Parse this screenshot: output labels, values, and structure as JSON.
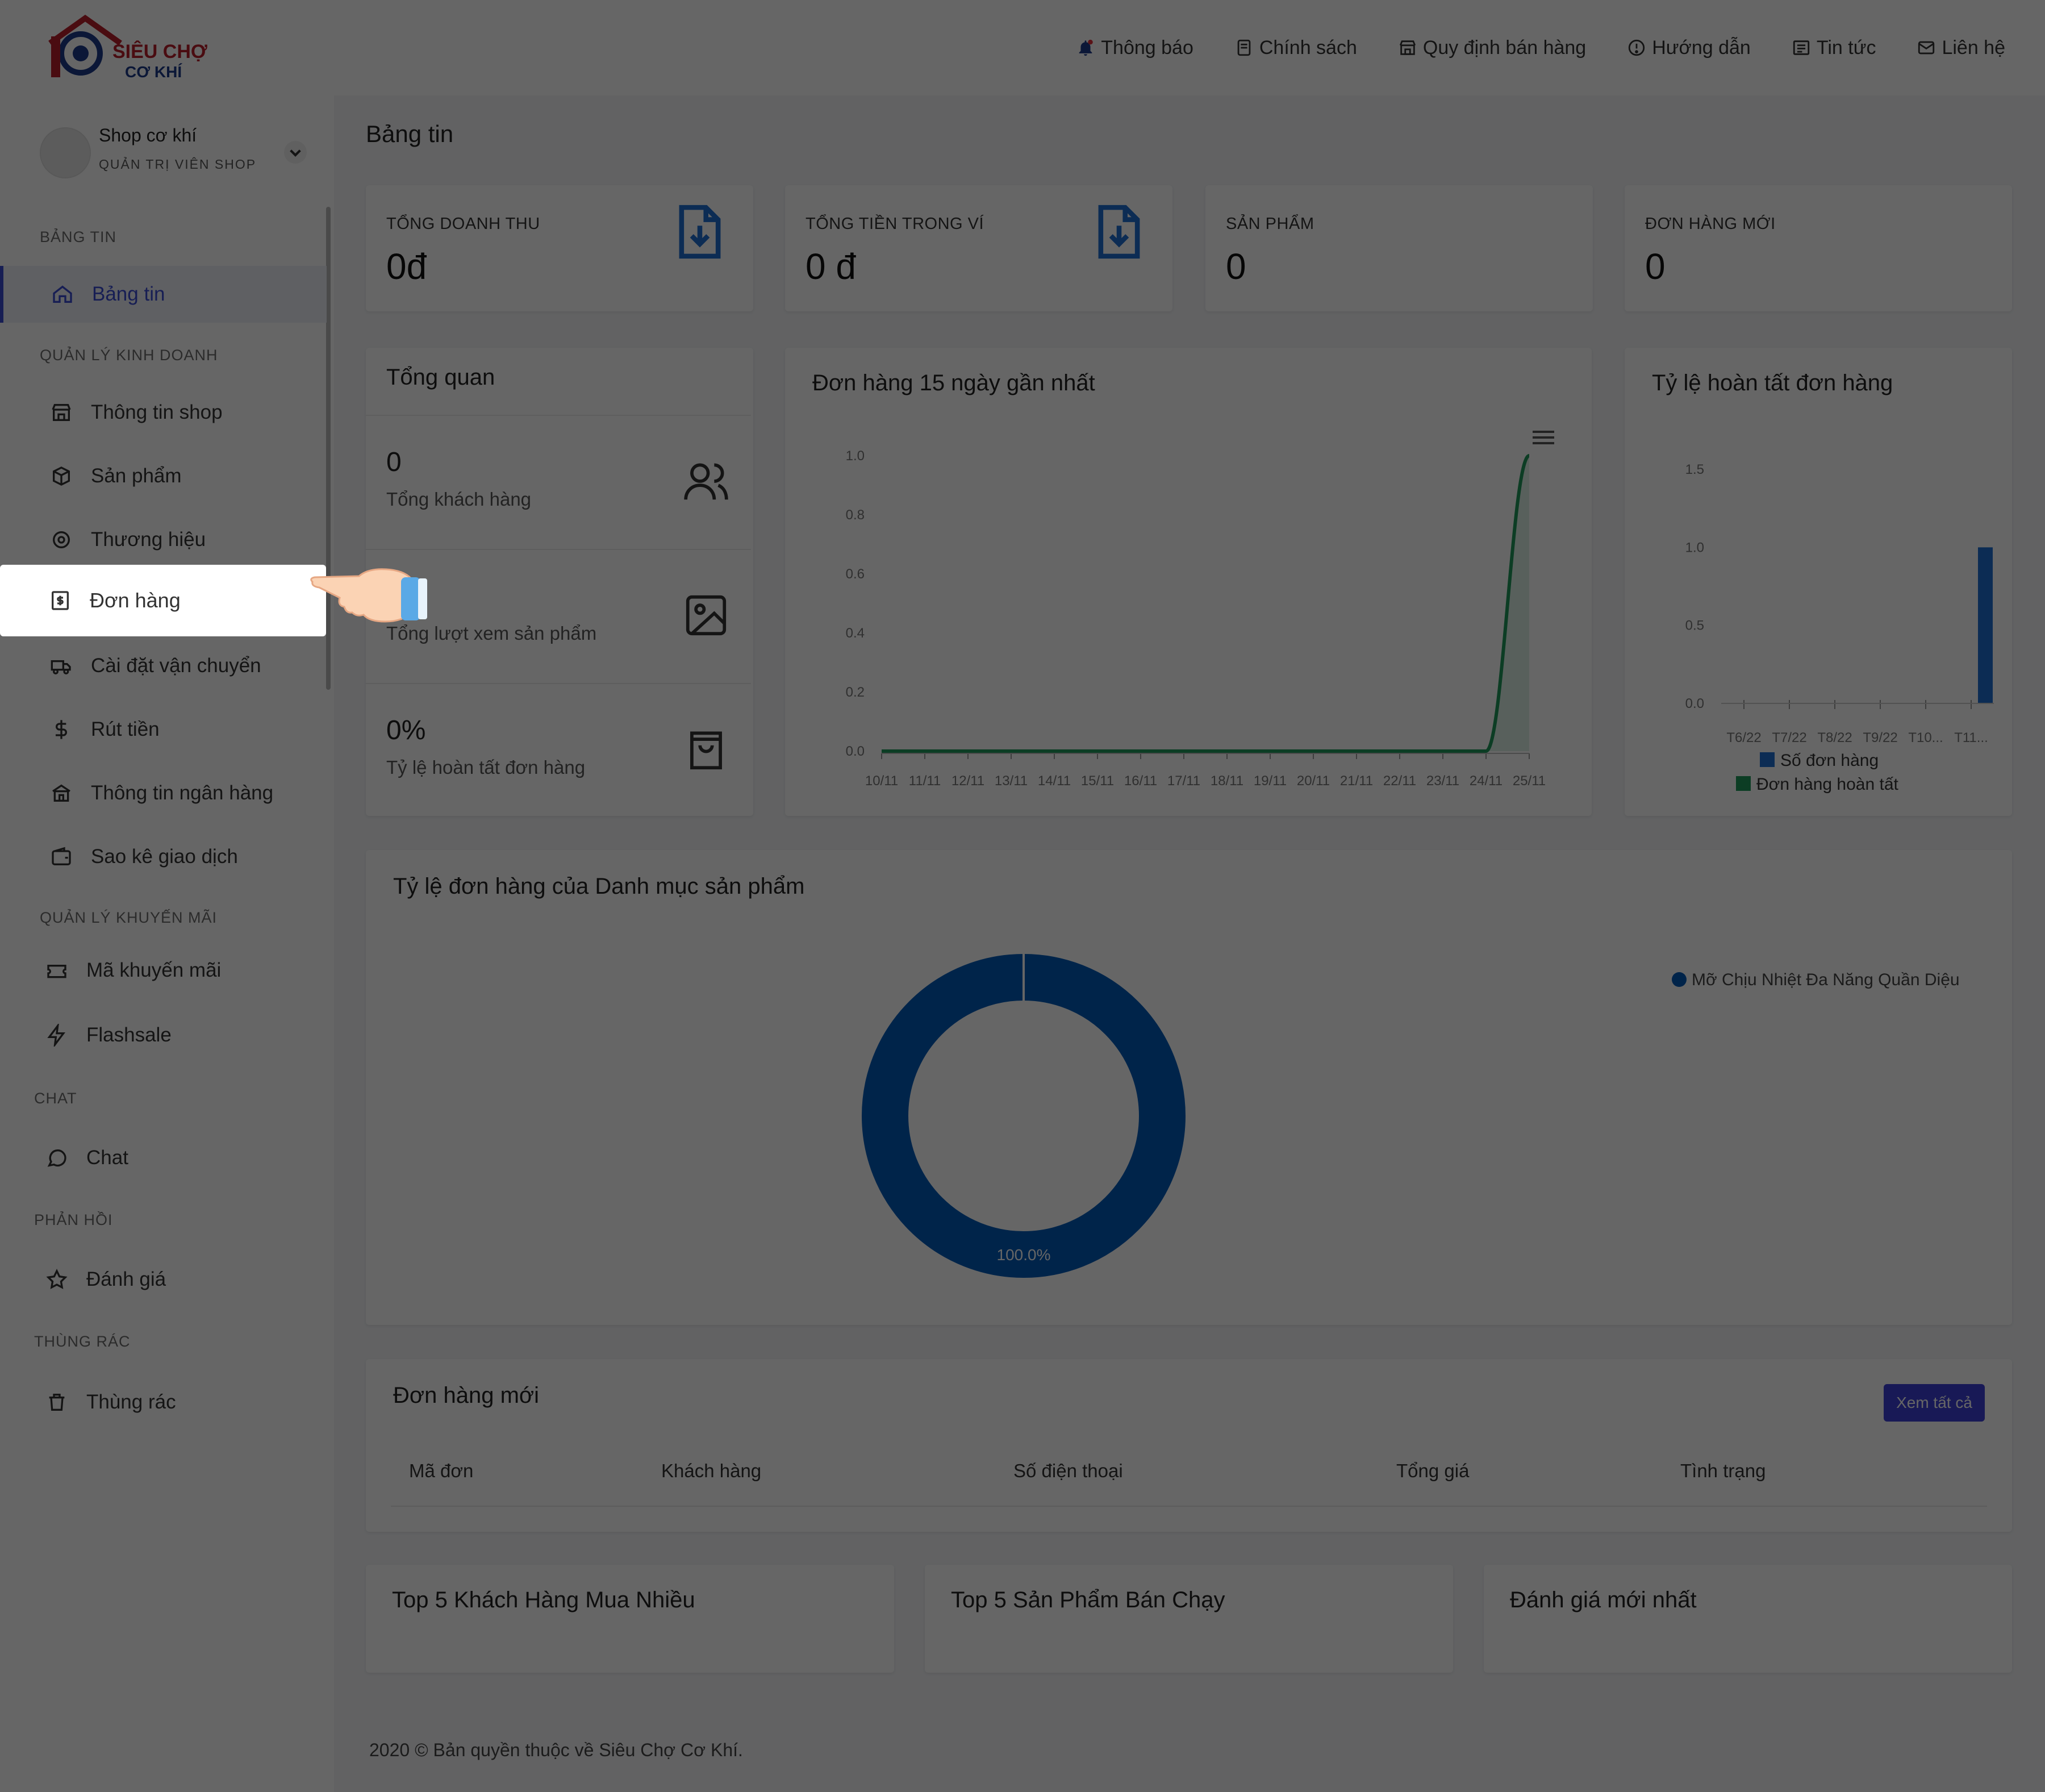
{
  "header": {
    "logo_text_top": "SIÊU CHỢ",
    "logo_text_bottom": "CƠ KHÍ",
    "nav": [
      {
        "label": "Thông báo",
        "icon": "bell-icon"
      },
      {
        "label": "Chính sách",
        "icon": "book-icon"
      },
      {
        "label": "Quy định bán hàng",
        "icon": "store-icon"
      },
      {
        "label": "Hướng dẫn",
        "icon": "help-circle-icon"
      },
      {
        "label": "Tin tức",
        "icon": "newspaper-icon"
      },
      {
        "label": "Liên hệ",
        "icon": "mail-icon"
      }
    ]
  },
  "profile": {
    "name": "Shop cơ khí",
    "role": "QUẢN TRỊ VIÊN SHOP"
  },
  "sidebar": {
    "sections": [
      "BẢNG TIN",
      "QUẢN LÝ KINH DOANH",
      "QUẢN LÝ KHUYẾN MÃI",
      "CHAT",
      "PHẢN HỒI",
      "THÙNG RÁC"
    ],
    "items": [
      {
        "label": "Bảng tin",
        "icon": "home-icon"
      },
      {
        "label": "Thông tin shop",
        "icon": "shop-icon"
      },
      {
        "label": "Sản phẩm",
        "icon": "box-icon"
      },
      {
        "label": "Thương hiệu",
        "icon": "gear-icon"
      },
      {
        "label": "Đơn hàng",
        "icon": "invoice-icon"
      },
      {
        "label": "Cài đặt vận chuyển",
        "icon": "truck-icon"
      },
      {
        "label": "Rút tiền",
        "icon": "dollar-icon"
      },
      {
        "label": "Thông tin ngân hàng",
        "icon": "bank-icon"
      },
      {
        "label": "Sao kê giao dịch",
        "icon": "wallet-icon"
      },
      {
        "label": "Mã khuyến mãi",
        "icon": "ticket-icon"
      },
      {
        "label": "Flashsale",
        "icon": "flash-icon"
      },
      {
        "label": "Chat",
        "icon": "chat-icon"
      },
      {
        "label": "Đánh giá",
        "icon": "star-icon"
      },
      {
        "label": "Thùng rác",
        "icon": "trash-icon"
      }
    ]
  },
  "page_title": "Bảng tin",
  "stats": [
    {
      "label": "TỔNG DOANH THU",
      "value": "0đ"
    },
    {
      "label": "TỔNG TIỀN TRONG VÍ",
      "value": "0 đ"
    },
    {
      "label": "SẢN PHẨM",
      "value": "0"
    },
    {
      "label": "ĐƠN HÀNG MỚI",
      "value": "0"
    }
  ],
  "overview": {
    "title": "Tổng quan",
    "rows": [
      {
        "value": "0",
        "label": "Tổng khách hàng"
      },
      {
        "value": "",
        "label": "Tổng lượt xem sản phẩm"
      },
      {
        "value": "0%",
        "label": "Tỷ lệ hoàn tất đơn hàng"
      }
    ]
  },
  "colors": {
    "primary": "#3b4bd2",
    "line_green": "#1e9a5a",
    "bar_blue": "#1f6fd1",
    "donut": "#005bb8"
  },
  "chart_data": [
    {
      "type": "line",
      "title": "Đơn hàng 15 ngày gần nhất",
      "x": [
        "10/11",
        "11/11",
        "12/11",
        "13/11",
        "14/11",
        "15/11",
        "16/11",
        "17/11",
        "18/11",
        "19/11",
        "20/11",
        "21/11",
        "22/11",
        "23/11",
        "24/11",
        "25/11"
      ],
      "series": [
        {
          "values": [
            0,
            0,
            0,
            0,
            0,
            0,
            0,
            0,
            0,
            0,
            0,
            0,
            0,
            0,
            0,
            1
          ]
        }
      ],
      "yticks": [
        "0.0",
        "0.2",
        "0.4",
        "0.6",
        "0.8",
        "1.0"
      ],
      "ylim": [
        0,
        1
      ]
    },
    {
      "type": "bar",
      "title": "Tỷ lệ hoàn tất đơn hàng",
      "categories": [
        "T6/22",
        "T7/22",
        "T8/22",
        "T9/22",
        "T10...",
        "T11..."
      ],
      "series": [
        {
          "name": "Số đơn hàng",
          "values": [
            0,
            0,
            0,
            0,
            0,
            1
          ]
        },
        {
          "name": "Đơn hàng hoàn tất",
          "values": [
            0,
            0,
            0,
            0,
            0,
            0
          ]
        }
      ],
      "yticks": [
        "0.0",
        "0.5",
        "1.0",
        "1.5"
      ],
      "ylim": [
        0,
        1.5
      ]
    },
    {
      "type": "pie",
      "title": "Tỷ lệ đơn hàng của Danh mục sản phẩm",
      "slices": [
        {
          "name": "Mỡ Chịu Nhiệt Đa Năng Quần Diệu",
          "value": 100
        }
      ],
      "slice_label": "100.0%"
    }
  ],
  "new_orders": {
    "title": "Đơn hàng mới",
    "view_all": "Xem tất cả",
    "columns": [
      "Mã đơn",
      "Khách hàng",
      "Số điện thoại",
      "Tổng giá",
      "Tình trạng"
    ]
  },
  "bottom_cards": [
    "Top 5 Khách Hàng Mua Nhiều",
    "Top 5 Sản Phẩm Bán Chạy",
    "Đánh giá mới nhất"
  ],
  "footer": "2020 © Bản quyền thuộc về Siêu Chợ Cơ Khí."
}
